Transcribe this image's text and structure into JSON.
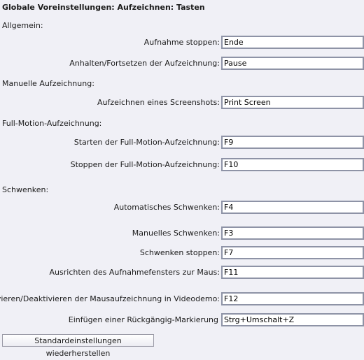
{
  "title": "Globale Voreinstellungen: Aufzeichnen: Tasten",
  "sections": {
    "general": "Allgemein:",
    "manual": "Manuelle Aufzeichnung:",
    "fullmotion": "Full-Motion-Aufzeichnung:",
    "panning": "Schwenken:"
  },
  "rows": [
    {
      "label": "Aufnahme stoppen:",
      "value": "Ende"
    },
    {
      "label": "Anhalten/Fortsetzen der Aufzeichnung:",
      "value": "Pause"
    },
    {
      "label": "Aufzeichnen eines Screenshots:",
      "value": "Print Screen"
    },
    {
      "label": "Starten der Full-Motion-Aufzeichnung:",
      "value": "F9"
    },
    {
      "label": "Stoppen der Full-Motion-Aufzeichnung:",
      "value": "F10"
    },
    {
      "label": "Automatisches Schwenken:",
      "value": "F4"
    },
    {
      "label": "Manuelles Schwenken:",
      "value": "F3"
    },
    {
      "label": "Schwenken stoppen:",
      "value": "F7"
    },
    {
      "label": "Ausrichten des Aufnahmefensters zur Maus:",
      "value": "F11"
    },
    {
      "label": "Aktivieren/Deaktivieren der Mausaufzeichnung in Videodemo:",
      "value": "F12"
    },
    {
      "label": "Einfügen einer Rückgängig-Markierung",
      "value": "Strg+Umschalt+Z"
    }
  ],
  "restore_defaults_label": "Standardeinstellungen wiederherstellen"
}
